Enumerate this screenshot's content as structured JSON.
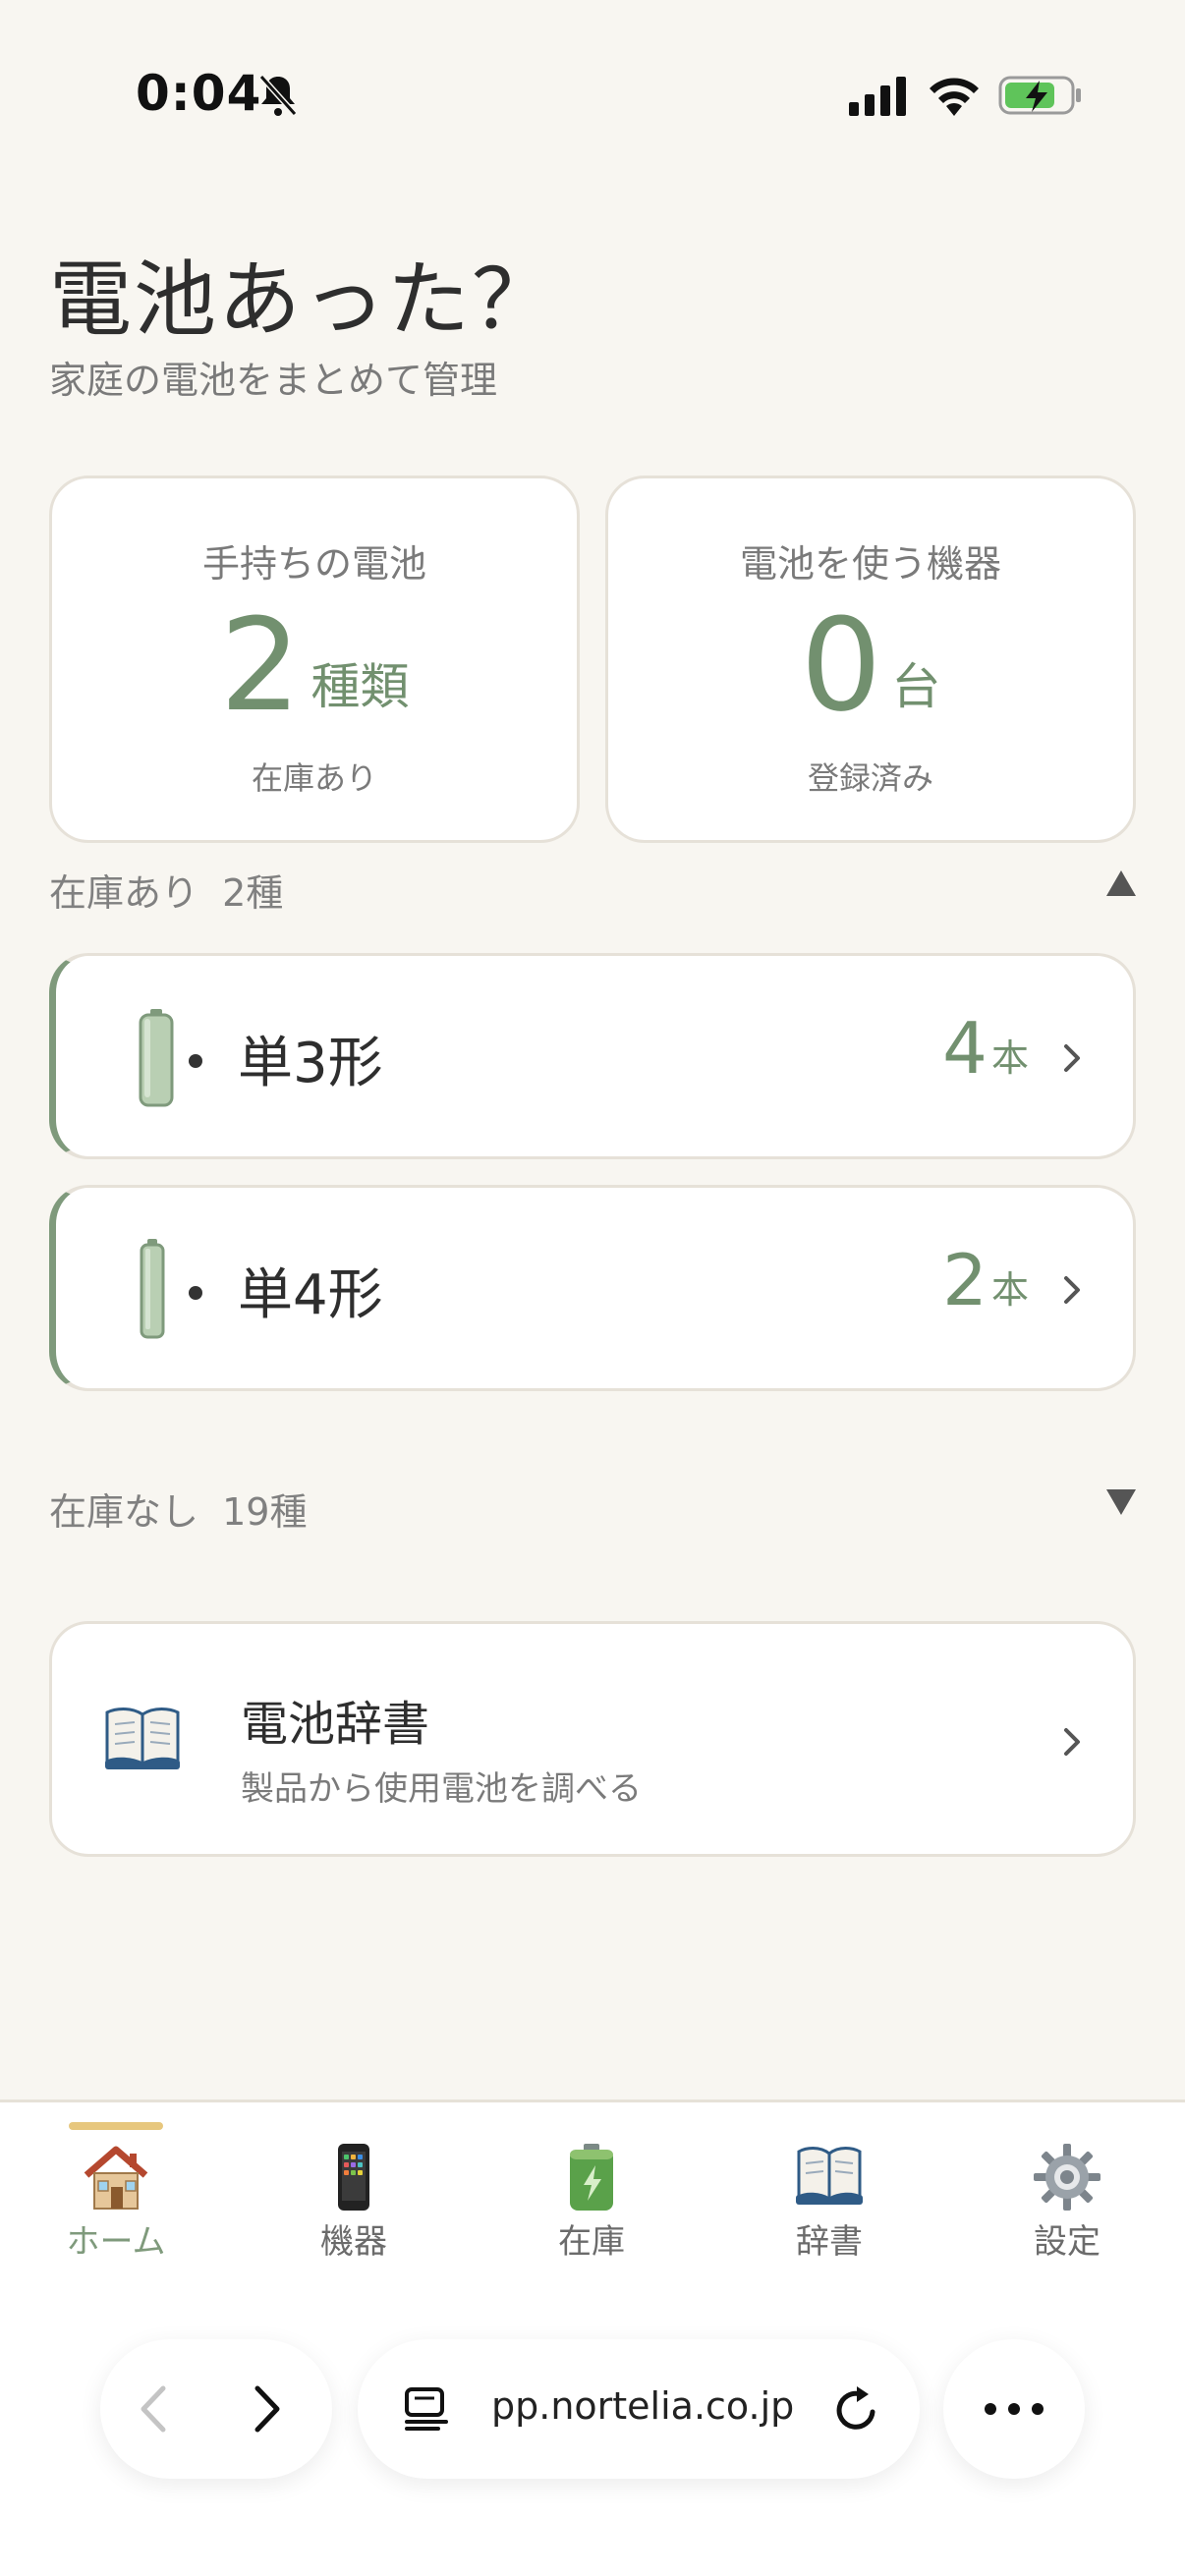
{
  "status_bar": {
    "time": "0:04",
    "icons": [
      "bell-slash-icon",
      "signal-icon",
      "wifi-icon",
      "battery-charging-icon"
    ]
  },
  "header": {
    "title": "電池あった？",
    "subtitle": "家庭の電池をまとめて管理"
  },
  "stats": {
    "owned": {
      "label": "手持ちの電池",
      "value": "2",
      "unit": "種類",
      "caption": "在庫あり"
    },
    "devices": {
      "label": "電池を使う機器",
      "value": "0",
      "unit": "台",
      "caption": "登録済み"
    }
  },
  "in_stock_section": {
    "title": "在庫あり",
    "count": "2種",
    "toggle_icon": "triangle-up-icon",
    "items": [
      {
        "name": "単3形",
        "count": "4",
        "unit": "本",
        "icon": "aa-battery-icon"
      },
      {
        "name": "単4形",
        "count": "2",
        "unit": "本",
        "icon": "aaa-battery-icon"
      }
    ]
  },
  "out_of_stock_section": {
    "title": "在庫なし",
    "count": "19種",
    "toggle_icon": "triangle-down-icon"
  },
  "dictionary_card": {
    "title": "電池辞書",
    "subtitle": "製品から使用電池を調べる",
    "icon": "open-book-icon"
  },
  "bottom_nav": {
    "items": [
      {
        "label": "ホーム",
        "icon": "house-icon",
        "active": true
      },
      {
        "label": "機器",
        "icon": "mobile-phone-icon",
        "active": false
      },
      {
        "label": "在庫",
        "icon": "battery-icon",
        "active": false
      },
      {
        "label": "辞書",
        "icon": "open-book-icon",
        "active": false
      },
      {
        "label": "設定",
        "icon": "gear-icon",
        "active": false
      }
    ]
  },
  "browser": {
    "url": "pp.nortelia.co.jp"
  },
  "colors": {
    "background": "#f8f6f1",
    "accent_green": "#72906f",
    "card_border": "#e6e1d8",
    "indicator_yellow": "#e7c77e"
  }
}
